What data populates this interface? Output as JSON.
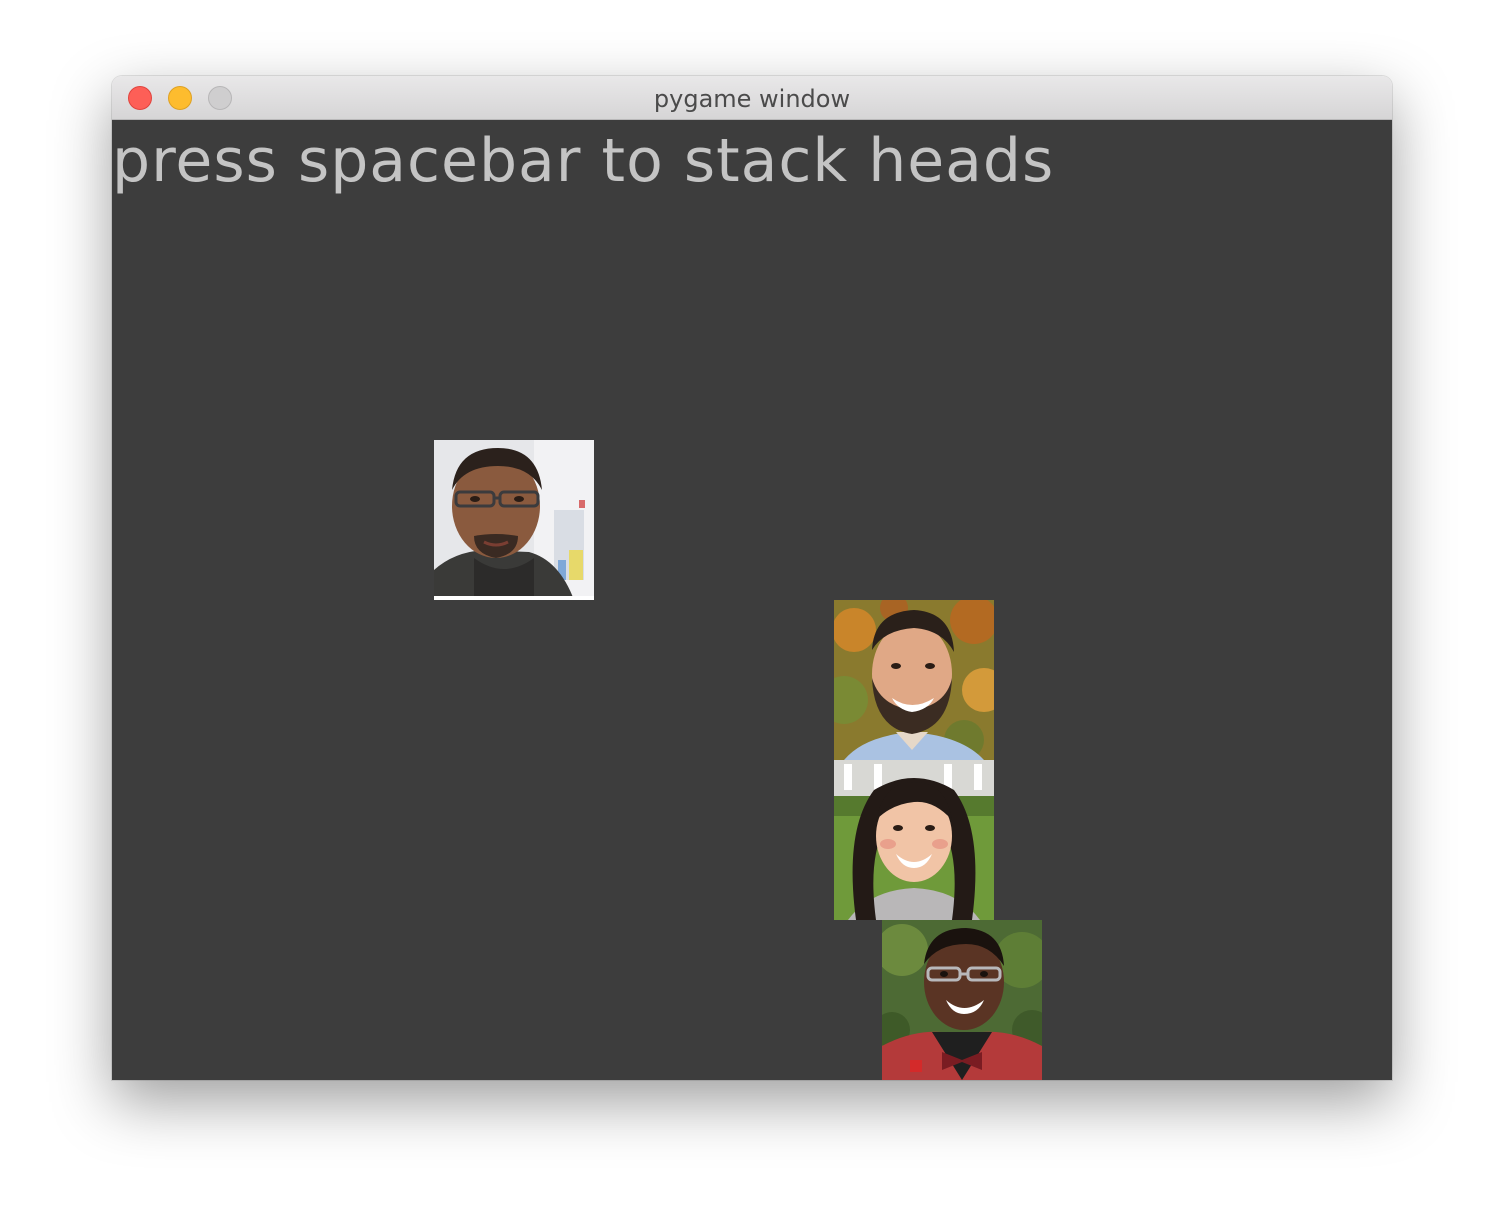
{
  "window": {
    "title": "pygame window",
    "controls": [
      "close-icon",
      "minimize-icon",
      "zoom-icon"
    ]
  },
  "game": {
    "instruction": "press spacebar to stack heads",
    "background_color": "#3d3d3d",
    "heads": [
      {
        "id": "head-1",
        "description": "man with glasses, office background"
      },
      {
        "id": "head-2",
        "description": "bearded man, autumn foliage background"
      },
      {
        "id": "head-3",
        "description": "smiling woman, lawn background"
      },
      {
        "id": "head-4",
        "description": "young man with bow tie, green background"
      }
    ]
  }
}
